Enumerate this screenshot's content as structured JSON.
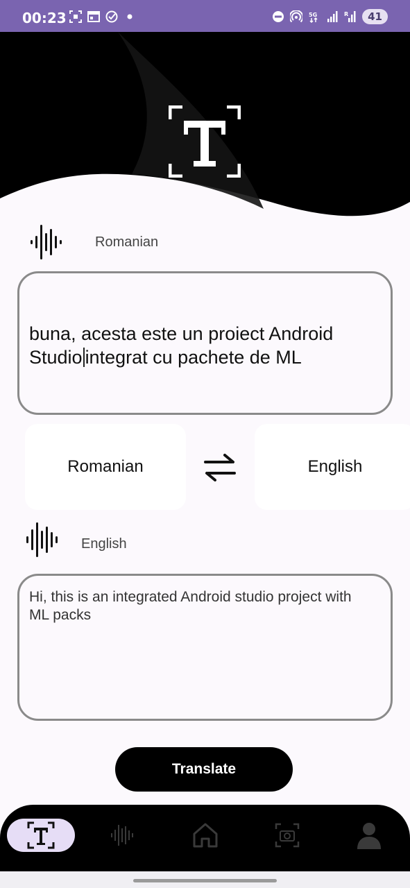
{
  "status_bar": {
    "time": "00:23",
    "battery": "41",
    "network": "5G"
  },
  "header": {
    "logo_icon": "text-recognition-icon",
    "background_color": "#000000"
  },
  "source": {
    "language_label": "Romanian",
    "text_before_cursor": "buna,  acesta este un proiect Android Studio",
    "text_after_cursor": "integrat cu pachete de ML",
    "icon": "audio-wave-icon"
  },
  "language_selector": {
    "source_language": "Romanian",
    "target_language": "English",
    "swap_icon": "swap-arrows-icon"
  },
  "target": {
    "language_label": "English",
    "text": "Hi, this is an integrated Android studio project with ML packs",
    "icon": "audio-wave-icon"
  },
  "actions": {
    "translate_label": "Translate"
  },
  "bottom_nav": {
    "items": [
      {
        "icon": "text-scan-icon",
        "active": true
      },
      {
        "icon": "audio-wave-icon",
        "active": false
      },
      {
        "icon": "home-icon",
        "active": false
      },
      {
        "icon": "camera-icon",
        "active": false
      },
      {
        "icon": "profile-icon",
        "active": false
      }
    ]
  },
  "colors": {
    "accent": "#7a64b0",
    "active_nav": "#e6ddf6",
    "primary_button": "#000000"
  }
}
